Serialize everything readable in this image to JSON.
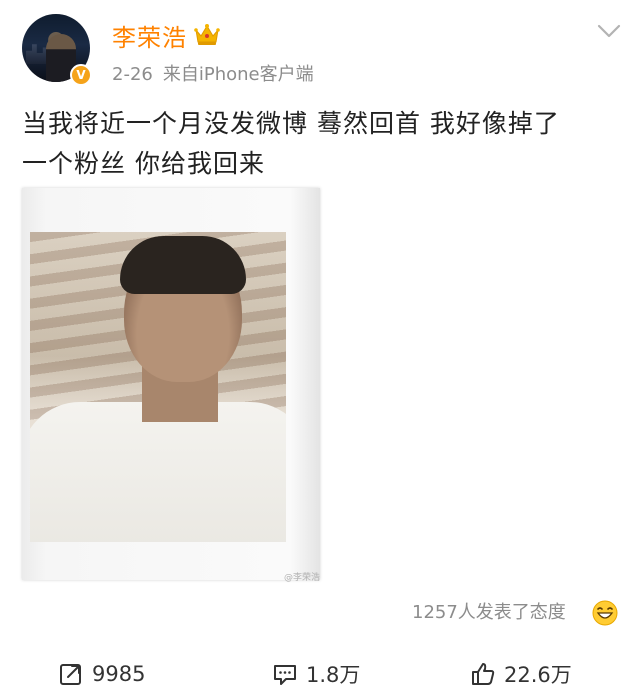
{
  "user": {
    "name": "李荣浩",
    "verified_badge": "V",
    "date": "2-26",
    "source": "来自iPhone客户端",
    "crown_icon": "crown-icon",
    "name_color": "#ff8200"
  },
  "post": {
    "lines": [
      "当我将近一个月没发微博  蓦然回首 我好像掉了",
      "一个粉丝  你给我回来"
    ],
    "photo_watermark": "@李荣浩"
  },
  "reactions": {
    "text": "1257人发表了态度",
    "icon": "laughing-emoji-icon"
  },
  "actions": {
    "repost_count": "9985",
    "comment_count": "1.8万",
    "like_count": "22.6万"
  }
}
